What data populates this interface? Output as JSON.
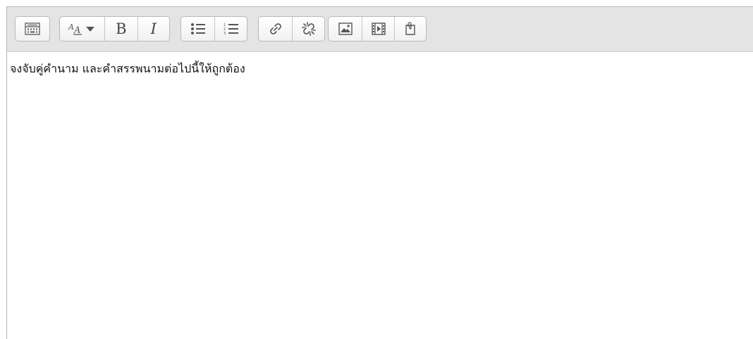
{
  "toolbar": {
    "toggle_label": "Show more buttons",
    "font_label": "Font style",
    "bold_label": "B",
    "italic_label": "I",
    "bullet_list_label": "Unordered list",
    "number_list_label": "Ordered list",
    "link_label": "Link",
    "unlink_label": "Unlink",
    "image_label": "Insert image",
    "media_label": "Insert media",
    "file_label": "Manage files"
  },
  "content": {
    "text": "จงจับคู่คำนาม และคำสรรพนามต่อไปนี้ให้ถูกต้อง"
  },
  "icons": [
    "keyboard-icon",
    "font-style-icon",
    "bold-icon",
    "italic-icon",
    "bullet-list-icon",
    "numbered-list-icon",
    "link-icon",
    "unlink-icon",
    "image-icon",
    "media-icon",
    "file-icon"
  ],
  "colors": {
    "toolbar_bg": "#e4e4e4",
    "icon": "#555555",
    "border": "#b9b9b9"
  }
}
